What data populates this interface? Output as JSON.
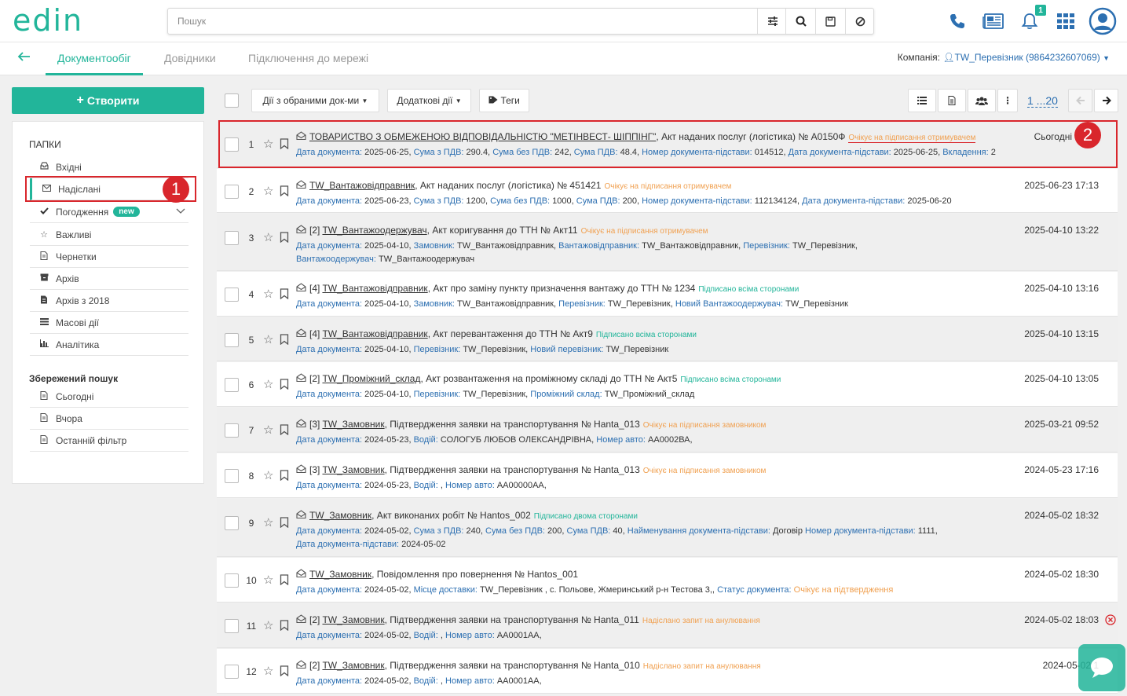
{
  "header": {
    "logo": "edin",
    "search_placeholder": "Пошук",
    "notification_count": "1"
  },
  "nav": {
    "tabs": [
      "Документообіг",
      "Довідники",
      "Підключення до мережі"
    ],
    "company_label": "Компанія:",
    "company_name": "TW_Перевізник (9864232607069)"
  },
  "sidebar": {
    "create_label": "Створити",
    "folders_title": "ПАПКИ",
    "folders": [
      {
        "label": "Вхідні",
        "icon": "inbox-icon"
      },
      {
        "label": "Надіслані",
        "icon": "envelope-icon"
      },
      {
        "label": "Погодження",
        "icon": "check-icon",
        "pill": "new"
      },
      {
        "label": "Важливі",
        "icon": "star-icon"
      },
      {
        "label": "Чернетки",
        "icon": "draft-icon"
      },
      {
        "label": "Архів",
        "icon": "archive-icon"
      },
      {
        "label": "Архів з 2018",
        "icon": "archive-file-icon"
      },
      {
        "label": "Масові дії",
        "icon": "list-icon"
      },
      {
        "label": "Аналітика",
        "icon": "chart-icon"
      }
    ],
    "saved_title": "Збережений пошук",
    "saved": [
      {
        "label": "Сьогодні"
      },
      {
        "label": "Вчора"
      },
      {
        "label": "Останній фільтр"
      }
    ]
  },
  "toolbar": {
    "actions_label": "Дії з обраними док-ми",
    "extra_label": "Додаткові дії",
    "tags_label": "Теги",
    "pager": "1 ...20"
  },
  "annotations": {
    "one": "1",
    "two": "2"
  },
  "rows": [
    {
      "num": "1",
      "prefix": "",
      "name": "ТОВАРИСТВО З ОБМЕЖЕНОЮ ВІДПОВІДАЛЬНІСТЮ \"МЕТІНВЕСТ- ШІППІНГ\"",
      "title": ", Акт наданих послуг (логістика) № А0150Ф",
      "status": "Очікує на підписання отримувачем",
      "status_color": "orange",
      "date": "Сьогодні",
      "meta": [
        [
          [
            "Дата документа:",
            "2025-06-25,"
          ],
          [
            "Сума з ПДВ:",
            "290.4,"
          ],
          [
            "Сума без ПДВ:",
            "242,"
          ],
          [
            "Сума ПДВ:",
            "48.4,"
          ],
          [
            "Номер документа-підстави:",
            "014512,"
          ],
          [
            "Дата документа-підстави:",
            "2025-06-25,"
          ],
          [
            "Вкладення:",
            "2"
          ]
        ]
      ]
    },
    {
      "num": "2",
      "prefix": "",
      "name": "TW_Вантажовідправник",
      "title": ", Акт наданих послуг (логістика) № 451421",
      "status": "Очікує на підписання отримувачем",
      "status_color": "orange",
      "date": "2025-06-23 17:13",
      "meta": [
        [
          [
            "Дата документа:",
            "2025-06-23,"
          ],
          [
            "Сума з ПДВ:",
            "1200,"
          ],
          [
            "Сума без ПДВ:",
            "1000,"
          ],
          [
            "Сума ПДВ:",
            "200,"
          ],
          [
            "Номер документа-підстави:",
            "112134124,"
          ],
          [
            "Дата документа-підстави:",
            "2025-06-20"
          ]
        ]
      ]
    },
    {
      "num": "3",
      "prefix": "[2]",
      "name": "TW_Вантажоодержувач",
      "title": ", Акт коригування до ТТН № Акт11",
      "status": "Очікує на підписання отримувачем",
      "status_color": "orange",
      "date": "2025-04-10 13:22",
      "meta": [
        [
          [
            "Дата документа:",
            "2025-04-10,"
          ],
          [
            "Замовник:",
            "TW_Вантажовідправник,"
          ],
          [
            "Вантажовідправник:",
            "TW_Вантажовідправник,"
          ],
          [
            "Перевізник:",
            "TW_Перевізник,"
          ]
        ],
        [
          [
            "Вантажоодержувач:",
            "TW_Вантажоодержувач"
          ]
        ]
      ]
    },
    {
      "num": "4",
      "prefix": "[4]",
      "name": "TW_Вантажовідправник",
      "title": ", Акт про заміну пункту призначення вантажу до ТТН № 1234",
      "status": "Підписано всіма сторонами",
      "status_color": "green",
      "date": "2025-04-10 13:16",
      "meta": [
        [
          [
            "Дата документа:",
            "2025-04-10,"
          ],
          [
            "Замовник:",
            "TW_Вантажовідправник,"
          ],
          [
            "Перевізник:",
            "TW_Перевізник,"
          ],
          [
            "Новий Вантажоодержувач:",
            "TW_Перевізник"
          ]
        ]
      ]
    },
    {
      "num": "5",
      "prefix": "[4]",
      "name": "TW_Вантажовідправник",
      "title": ", Акт перевантаження до ТТН № Акт9",
      "status": "Підписано всіма сторонами",
      "status_color": "green",
      "date": "2025-04-10 13:15",
      "meta": [
        [
          [
            "Дата документа:",
            "2025-04-10,"
          ],
          [
            "Перевізник:",
            "TW_Перевізник,"
          ],
          [
            "Новий перевізник:",
            "TW_Перевізник"
          ]
        ]
      ]
    },
    {
      "num": "6",
      "prefix": "[2]",
      "name": "TW_Проміжний_склад",
      "title": ", Акт розвантаження на проміжному складі до ТТН № Акт5",
      "status": "Підписано всіма сторонами",
      "status_color": "green",
      "date": "2025-04-10 13:05",
      "meta": [
        [
          [
            "Дата документа:",
            "2025-04-10,"
          ],
          [
            "Перевізник:",
            "TW_Перевізник,"
          ],
          [
            "Проміжний склад:",
            "TW_Проміжний_склад"
          ]
        ]
      ]
    },
    {
      "num": "7",
      "prefix": "[3]",
      "name": "TW_Замовник",
      "title": ", Підтвердження заявки на транспортування № Hanta_013",
      "status": "Очікує на підписання замовником",
      "status_color": "orange",
      "date": "2025-03-21 09:52",
      "meta": [
        [
          [
            "Дата документа:",
            "2024-05-23,"
          ],
          [
            "Водій:",
            "СОЛОГУБ ЛЮБОВ ОЛЕКСАНДРІВНА,"
          ],
          [
            "Номер авто:",
            "АА0002ВА,"
          ]
        ]
      ]
    },
    {
      "num": "8",
      "prefix": "[3]",
      "name": "TW_Замовник",
      "title": ", Підтвердження заявки на транспортування № Hanta_013",
      "status": "Очікує на підписання замовником",
      "status_color": "orange",
      "date": "2024-05-23 17:16",
      "meta": [
        [
          [
            "Дата документа:",
            "2024-05-23,"
          ],
          [
            "Водій:",
            ","
          ],
          [
            "Номер авто:",
            "АА00000АА,"
          ]
        ]
      ]
    },
    {
      "num": "9",
      "prefix": "",
      "name": "TW_Замовник",
      "title": ", Акт виконаних робіт № Hantos_002",
      "status": "Підписано двома сторонами",
      "status_color": "green",
      "date": "2024-05-02 18:32",
      "meta": [
        [
          [
            "Дата документа:",
            "2024-05-02,"
          ],
          [
            "Сума з ПДВ:",
            "240,"
          ],
          [
            "Сума без ПДВ:",
            "200,"
          ],
          [
            "Сума ПДВ:",
            "40,"
          ],
          [
            "Найменування документа-підстави:",
            "Договір"
          ],
          [
            "Номер документа-підстави:",
            "1111,"
          ]
        ],
        [
          [
            "Дата документа-підстави:",
            "2024-05-02"
          ]
        ]
      ]
    },
    {
      "num": "10",
      "prefix": "",
      "name": "TW_Замовник",
      "title": ", Повідомлення про повернення № Hantos_001",
      "status": "",
      "status_color": "orange",
      "date": "2024-05-02 18:30",
      "meta": [
        [
          [
            "Дата документа:",
            "2024-05-02,"
          ],
          [
            "Місце доставки:",
            "TW_Перевізник , с. Польове, Жмеринський р-н Тестова 3,,"
          ],
          [
            "Статус документа:",
            ""
          ],
          [
            "",
            "Очікує на підтвердження"
          ]
        ]
      ]
    },
    {
      "num": "11",
      "prefix": "[2]",
      "name": "TW_Замовник",
      "title": ", Підтвердження заявки на транспортування № Hanta_011",
      "status": "Надіслано запит на анулювання",
      "status_color": "orange",
      "date": "2024-05-02 18:03",
      "meta": [
        [
          [
            "Дата документа:",
            "2024-05-02,"
          ],
          [
            "Водій:",
            ","
          ],
          [
            "Номер авто:",
            "АА0001АА,"
          ]
        ]
      ]
    },
    {
      "num": "12",
      "prefix": "[2]",
      "name": "TW_Замовник",
      "title": ", Підтвердження заявки на транспортування № Hanta_010",
      "status": "Надіслано запит на анулювання",
      "status_color": "orange",
      "date": "2024-05-02 1",
      "meta": [
        [
          [
            "Дата документа:",
            "2024-05-02,"
          ],
          [
            "Водій:",
            ","
          ],
          [
            "Номер авто:",
            "АА0001АА,"
          ]
        ]
      ]
    }
  ]
}
